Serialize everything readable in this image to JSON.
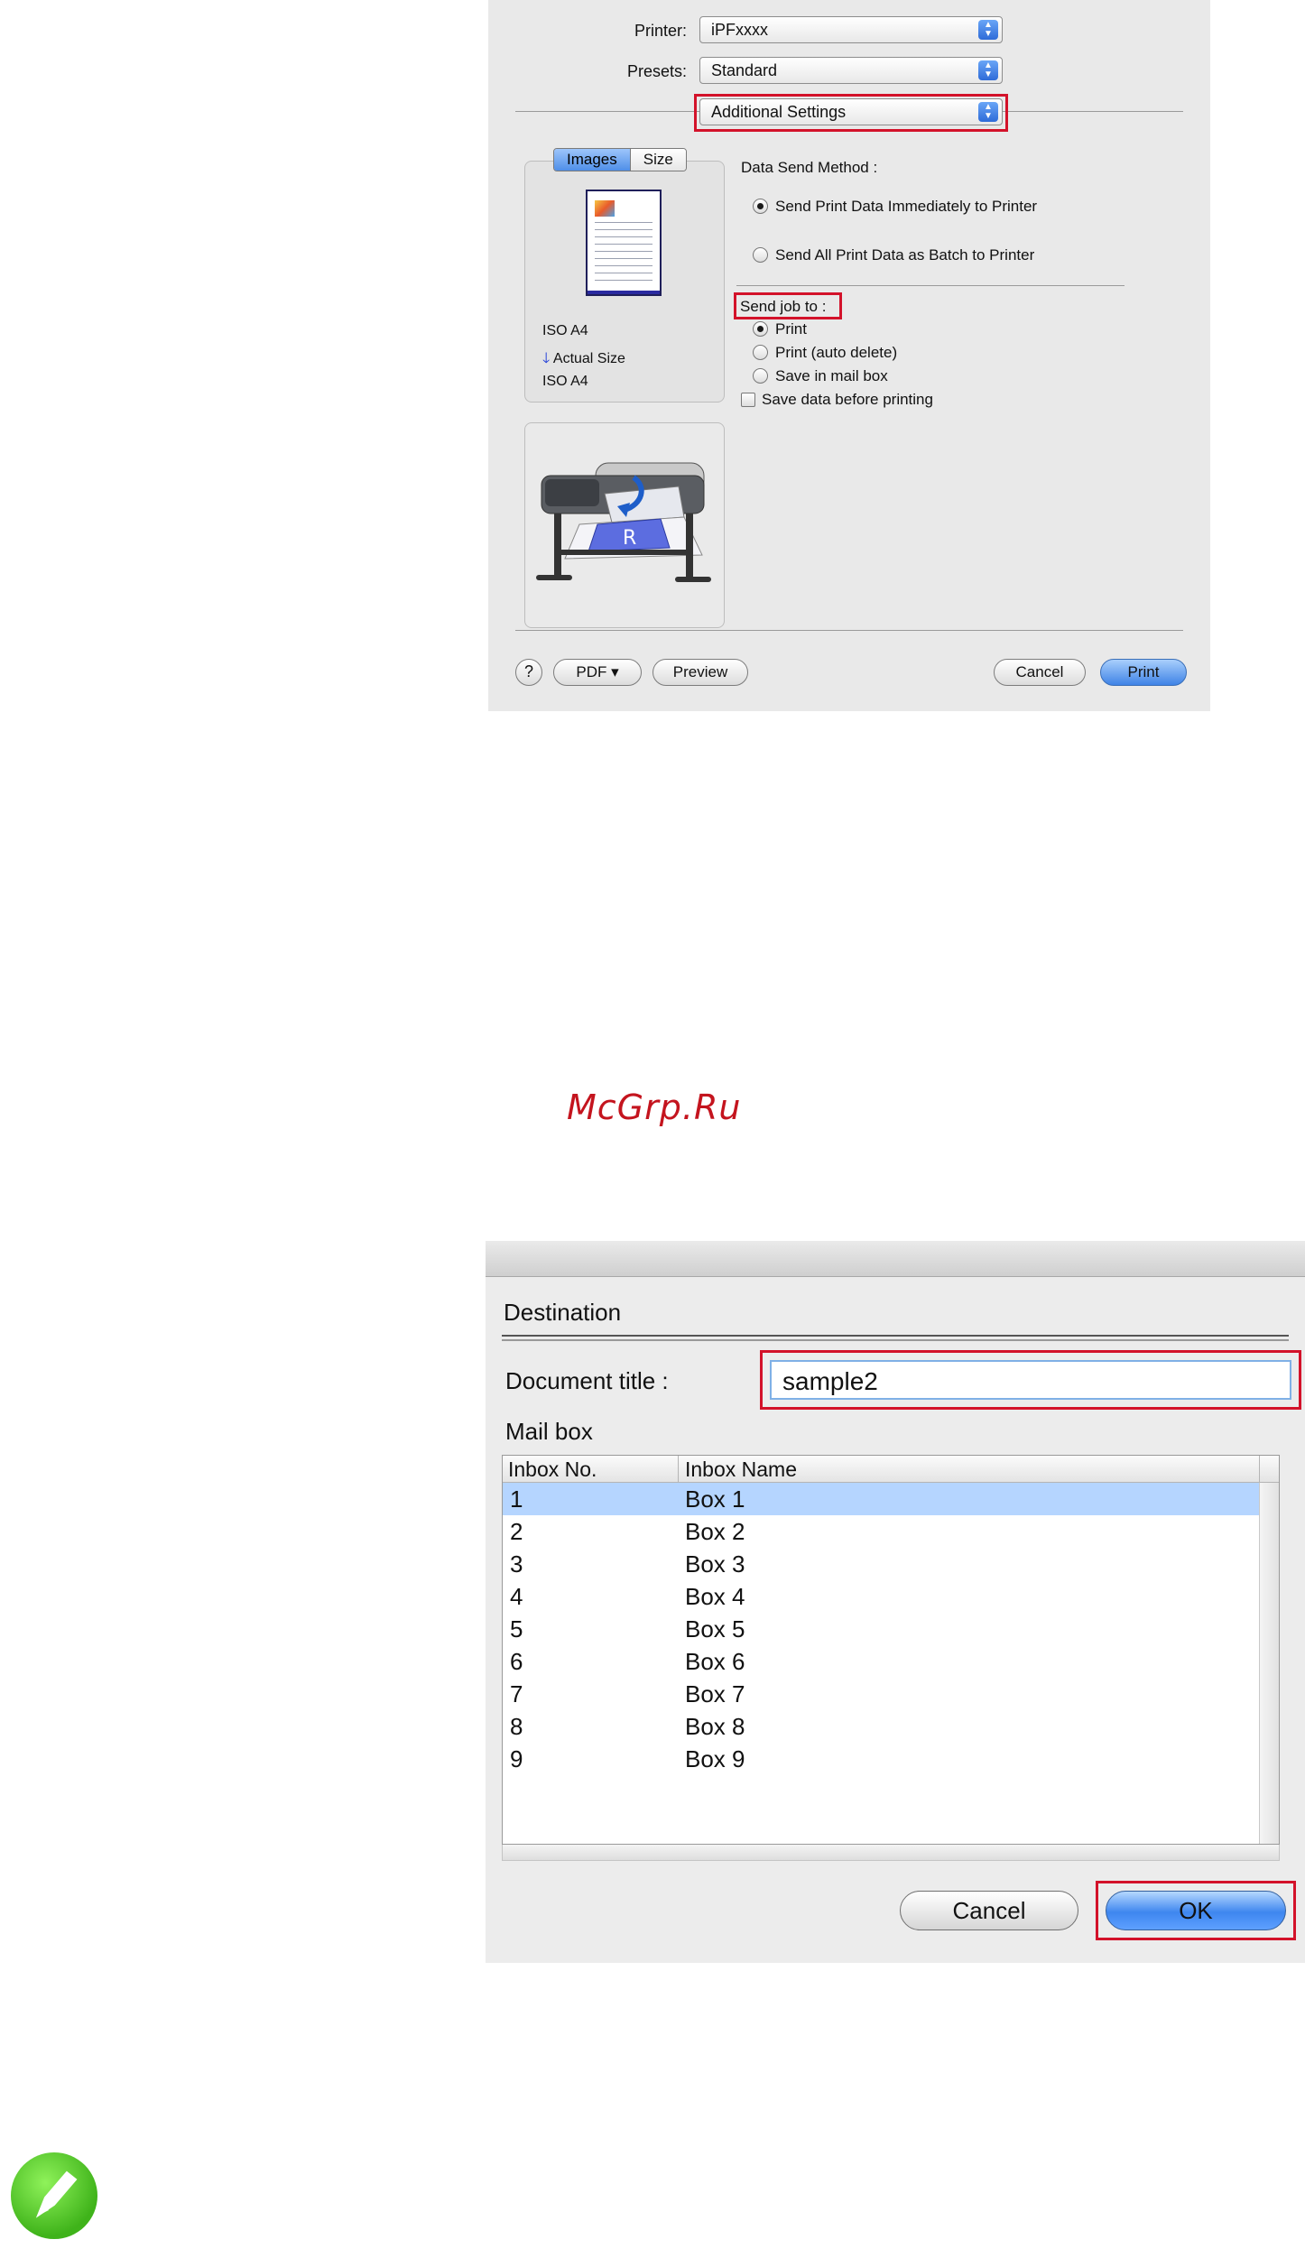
{
  "print_dialog": {
    "printer_label": "Printer:",
    "printer_value": "iPFxxxx",
    "presets_label": "Presets:",
    "presets_value": "Standard",
    "pane_value": "Additional Settings",
    "tabs": [
      "Images",
      "Size"
    ],
    "page_info": [
      "ISO A4",
      "Actual Size",
      "ISO A4"
    ],
    "data_send_method_label": "Data Send Method :",
    "send_options": [
      {
        "label": "Send Print Data Immediately to Printer",
        "selected": true
      },
      {
        "label": "Send All Print Data as Batch to Printer",
        "selected": false
      }
    ],
    "send_job_to_label": "Send job to :",
    "job_options": [
      {
        "label": "Print",
        "selected": true
      },
      {
        "label": "Print (auto delete)",
        "selected": false
      },
      {
        "label": "Save in mail box",
        "selected": false
      }
    ],
    "save_before_label": "Save data before printing",
    "save_before_checked": false,
    "help_label": "?",
    "pdf_label": "PDF ▾",
    "preview_label": "Preview",
    "cancel_label": "Cancel",
    "print_label": "Print"
  },
  "watermark": "McGrp.Ru",
  "destination_dialog": {
    "heading": "Destination",
    "document_title_label": "Document title :",
    "document_title_value": "sample2",
    "mailbox_label": "Mail box",
    "columns": [
      "Inbox No.",
      "Inbox Name"
    ],
    "rows": [
      {
        "no": "1",
        "name": "Box 1",
        "selected": true
      },
      {
        "no": "2",
        "name": "Box 2"
      },
      {
        "no": "3",
        "name": "Box 3"
      },
      {
        "no": "4",
        "name": "Box 4"
      },
      {
        "no": "5",
        "name": "Box 5"
      },
      {
        "no": "6",
        "name": "Box 6"
      },
      {
        "no": "7",
        "name": "Box 7"
      },
      {
        "no": "8",
        "name": "Box 8"
      },
      {
        "no": "9",
        "name": "Box 9"
      }
    ],
    "cancel_label": "Cancel",
    "ok_label": "OK"
  },
  "colors": {
    "highlight_red": "#d3122a",
    "selection_blue": "#b5d5ff",
    "button_blue": "#3e86ef",
    "watermark_red": "#c4141e",
    "note_green": "#3fb31a"
  },
  "icons": [
    "help-icon",
    "popup-arrows-icon",
    "printer-illustration",
    "page-preview-thumbnail",
    "note-pencil-icon"
  ]
}
